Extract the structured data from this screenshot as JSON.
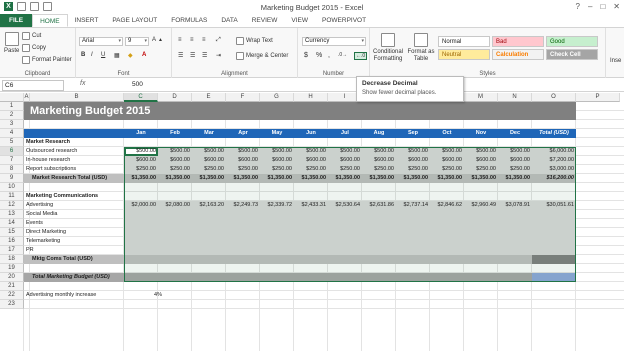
{
  "window": {
    "title": "Marketing Budget 2015 - Excel",
    "controls": [
      "?",
      "–",
      "□",
      "✕"
    ]
  },
  "tabs": [
    "FILE",
    "HOME",
    "INSERT",
    "PAGE LAYOUT",
    "FORMULAS",
    "DATA",
    "REVIEW",
    "VIEW",
    "POWERPIVOT"
  ],
  "ribbon": {
    "clipboard": {
      "label": "Clipboard",
      "paste": "Paste",
      "cut": "Cut",
      "copy": "Copy",
      "format_painter": "Format Painter"
    },
    "font": {
      "label": "Font",
      "name": "Arial",
      "size": "9",
      "bold": "B",
      "italic": "I",
      "underline": "U"
    },
    "alignment": {
      "label": "Alignment",
      "wrap": "Wrap Text",
      "merge": "Merge & Center"
    },
    "number": {
      "label": "Number",
      "format": "Currency",
      "dollar": "$",
      "percent": "%",
      "comma": ","
    },
    "styles": {
      "label": "Styles",
      "conditional": "Conditional Formatting",
      "format_table": "Format as Table",
      "normal": "Normal",
      "bad": "Bad",
      "good": "Good",
      "neutral": "Neutral",
      "calculation": "Calculation",
      "check_cell": "Check Cell",
      "colors": {
        "bad_bg": "#ffc7ce",
        "good_bg": "#c6efce",
        "neutral_bg": "#ffeb9c",
        "calc_bg": "#f2f2f2",
        "check_bg": "#a5a5a5"
      }
    },
    "insert_label": "Inse"
  },
  "formula_bar": {
    "name_box": "C6",
    "fx": "fx",
    "value": "500"
  },
  "tooltip": {
    "title": "Decrease Decimal",
    "description": "Show fewer decimal places."
  },
  "columns": [
    "A",
    "B",
    "C",
    "D",
    "E",
    "F",
    "G",
    "H",
    "I",
    "J",
    "K",
    "L",
    "M",
    "N",
    "O",
    "P"
  ],
  "rows": [
    "1",
    "2",
    "3",
    "4",
    "5",
    "6",
    "7",
    "8",
    "9",
    "10",
    "11",
    "12",
    "13",
    "14",
    "15",
    "16",
    "17",
    "18",
    "19",
    "20",
    "21",
    "22",
    "23"
  ],
  "sheet": {
    "title": "Marketing Budget 2015",
    "months": [
      "Jan",
      "Feb",
      "Mar",
      "Apr",
      "May",
      "Jun",
      "Jul",
      "Aug",
      "Sep",
      "Oct",
      "Nov",
      "Dec",
      "Total (USD)"
    ],
    "market_research_header": "Market Research",
    "outsourced": {
      "label": "Outsourced research",
      "values": [
        "$500.00",
        "$500.00",
        "$500.00",
        "$500.00",
        "$500.00",
        "$500.00",
        "$500.00",
        "$500.00",
        "$500.00",
        "$500.00",
        "$500.00",
        "$500.00",
        "$6,000.00"
      ]
    },
    "inhouse": {
      "label": "In-house research",
      "values": [
        "$600.00",
        "$600.00",
        "$600.00",
        "$600.00",
        "$600.00",
        "$600.00",
        "$600.00",
        "$600.00",
        "$600.00",
        "$600.00",
        "$600.00",
        "$600.00",
        "$7,200.00"
      ]
    },
    "reports": {
      "label": "Report subscriptions",
      "values": [
        "$250.00",
        "$250.00",
        "$250.00",
        "$250.00",
        "$250.00",
        "$250.00",
        "$250.00",
        "$250.00",
        "$250.00",
        "$250.00",
        "$250.00",
        "$250.00",
        "$3,000.00"
      ]
    },
    "mr_total": {
      "label": "Market Research Total (USD)",
      "values": [
        "$1,350.00",
        "$1,350.00",
        "$1,350.00",
        "$1,350.00",
        "$1,350.00",
        "$1,350.00",
        "$1,350.00",
        "$1,350.00",
        "$1,350.00",
        "$1,350.00",
        "$1,350.00",
        "$1,350.00",
        "$16,200.00"
      ]
    },
    "mc_header": "Marketing Communications",
    "advertising": {
      "label": "Advertising",
      "values": [
        "$2,000.00",
        "$2,080.00",
        "$2,163.20",
        "$2,249.73",
        "$2,339.72",
        "$2,433.31",
        "$2,530.64",
        "$2,631.86",
        "$2,737.14",
        "$2,846.62",
        "$2,960.49",
        "$3,078.91",
        "$30,051.61"
      ]
    },
    "social": "Social Media",
    "events": "Events",
    "direct": "Direct Marketing",
    "telemarketing": "Telemarketing",
    "pr": "PR",
    "mc_total": "Mktg Coms Total (USD)",
    "total_budget": "Total Marketing Budget (USD)",
    "adv_increase_label": "Advertising monthly increase",
    "adv_increase_value": "4%"
  }
}
